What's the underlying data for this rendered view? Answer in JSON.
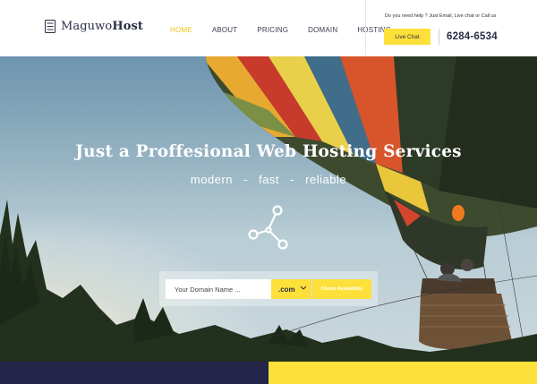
{
  "brand": {
    "name_regular": "Maguwo",
    "name_bold": "Host",
    "icon": "server-stack-icon"
  },
  "nav": {
    "items": [
      {
        "label": "HOME",
        "active": true
      },
      {
        "label": "ABOUT",
        "active": false
      },
      {
        "label": "PRICING",
        "active": false
      },
      {
        "label": "DOMAIN",
        "active": false
      },
      {
        "label": "HOSTING",
        "active": false
      }
    ]
  },
  "contact": {
    "help_text": "Do you need help ? Just Email, Live chat or Call us",
    "chat_label": "Live Chat",
    "phone": "6284-6534"
  },
  "hero": {
    "title": "Just a Proffesional Web Hosting Services",
    "tagline": [
      "modern",
      "fast",
      "reliable"
    ],
    "separator": "-",
    "icon": "share-icon"
  },
  "search": {
    "placeholder": "Your Domain Name ...",
    "tld": ".com",
    "check_label": "Check Availability"
  },
  "colors": {
    "accent": "#fde03a",
    "navy": "#23254a",
    "active_nav": "#f0c419"
  }
}
